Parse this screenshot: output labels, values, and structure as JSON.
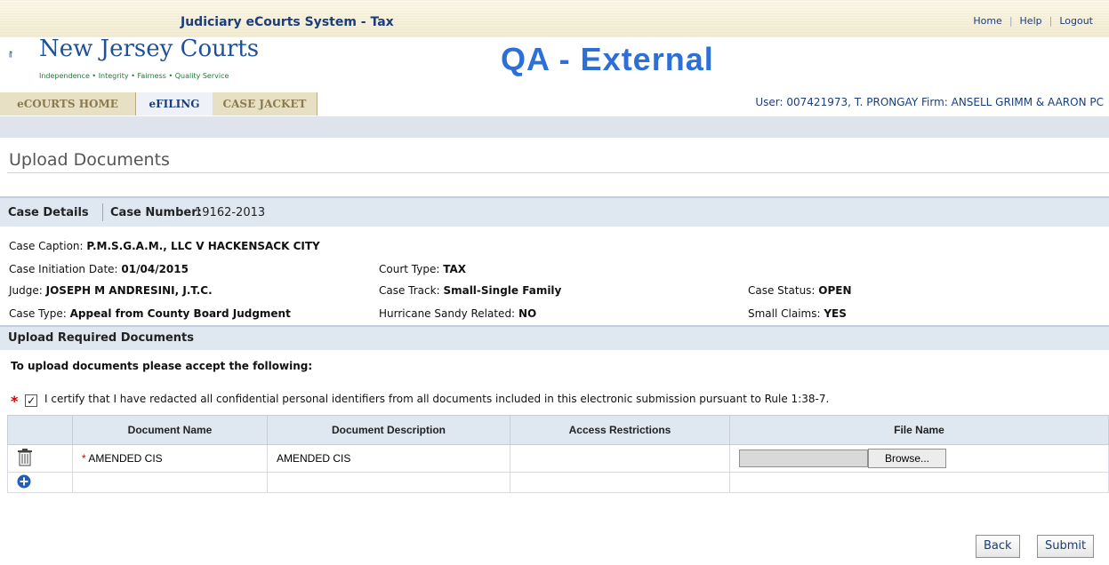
{
  "header": {
    "system_title": "Judiciary eCourts System - Tax",
    "links": [
      "Home",
      "Help",
      "Logout"
    ],
    "logo_text": "New Jersey Courts",
    "logo_tagline": "Independence • Integrity • Fairness • Quality Service",
    "environment": "QA - External"
  },
  "nav": {
    "tabs": [
      "eCOURTS HOME",
      "eFILING",
      "CASE JACKET"
    ],
    "active_tab": "eFILING",
    "user_info": "User: 007421973, T. PRONGAY  Firm: ANSELL GRIMM & AARON PC"
  },
  "page": {
    "title": "Upload Documents"
  },
  "case": {
    "section_label": "Case Details",
    "number_label": "Case Number:",
    "number_value": "19162-2013",
    "fields": {
      "caption_label": "Case Caption:",
      "caption_value": "P.M.S.G.A.M., LLC V HACKENSACK CITY",
      "initiation_label": "Case Initiation Date:",
      "initiation_value": "01/04/2015",
      "court_type_label": "Court Type:",
      "court_type_value": "TAX",
      "judge_label": "Judge:",
      "judge_value": "JOSEPH M ANDRESINI, J.T.C.",
      "track_label": "Case Track:",
      "track_value": "Small-Single Family",
      "status_label": "Case Status:",
      "status_value": "OPEN",
      "type_label": "Case Type:",
      "type_value": "Appeal from County Board Judgment",
      "hurricane_label": "Hurricane Sandy Related:",
      "hurricane_value": "NO",
      "small_claims_label": "Small Claims:",
      "small_claims_value": "YES"
    }
  },
  "upload": {
    "section_label": "Upload Required Documents",
    "accept_text": "To upload documents please accept the following:",
    "certify_text": "I certify that I have redacted all confidential personal identifiers from all documents included in this electronic submission pursuant to Rule 1:38-7.",
    "certify_checked": true,
    "table": {
      "headers": [
        "Document Name",
        "Document Description",
        "Access Restrictions",
        "File Name"
      ],
      "rows": [
        {
          "name": "AMENDED CIS",
          "description": "AMENDED CIS",
          "access": "",
          "file": ""
        }
      ],
      "browse_label": "Browse..."
    }
  },
  "actions": {
    "back": "Back",
    "submit": "Submit"
  },
  "colors": {
    "accent": "#2d6fd8",
    "header_blue": "#1b3d7a",
    "section_bg": "#dfe7f1",
    "required": "#cc0000"
  }
}
